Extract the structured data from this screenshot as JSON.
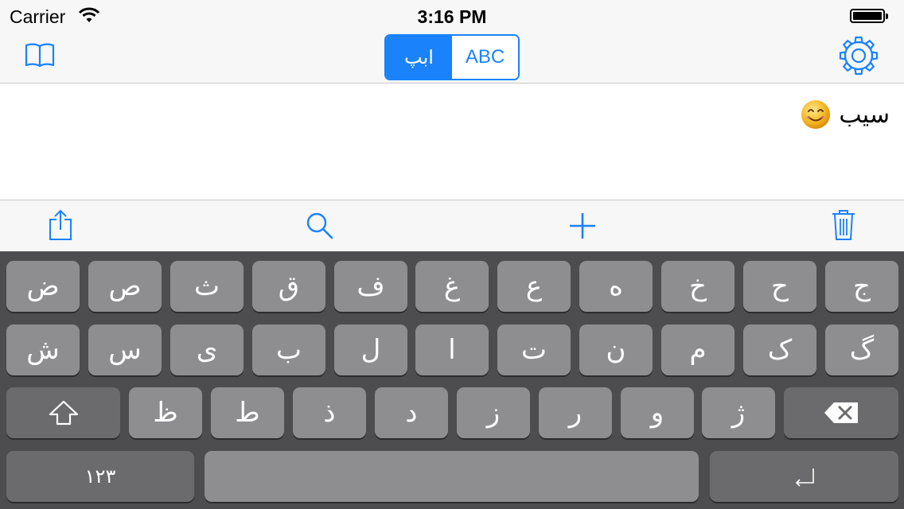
{
  "status_bar": {
    "carrier": "Carrier",
    "time": "3:16 PM"
  },
  "nav": {
    "segments": [
      {
        "label": "ابپ",
        "selected": true
      },
      {
        "label": "ABC",
        "selected": false
      }
    ]
  },
  "text": {
    "entry": "سیب"
  },
  "keyboard": {
    "row1": [
      "ض",
      "ص",
      "ث",
      "ق",
      "ف",
      "غ",
      "ع",
      "ه",
      "خ",
      "ح",
      "ج"
    ],
    "row2": [
      "ش",
      "س",
      "ی",
      "ب",
      "ل",
      "ا",
      "ت",
      "ن",
      "م",
      "ک",
      "گ"
    ],
    "row3": [
      "ظ",
      "ط",
      "ذ",
      "د",
      "ز",
      "ر",
      "و",
      "ژ"
    ],
    "numbers_label": "۱۲۳"
  },
  "colors": {
    "accent": "#1a82fb",
    "key": "#8e8e91",
    "key_dark": "#6b6b6d",
    "keyboard_bg": "#4d4d4f"
  }
}
